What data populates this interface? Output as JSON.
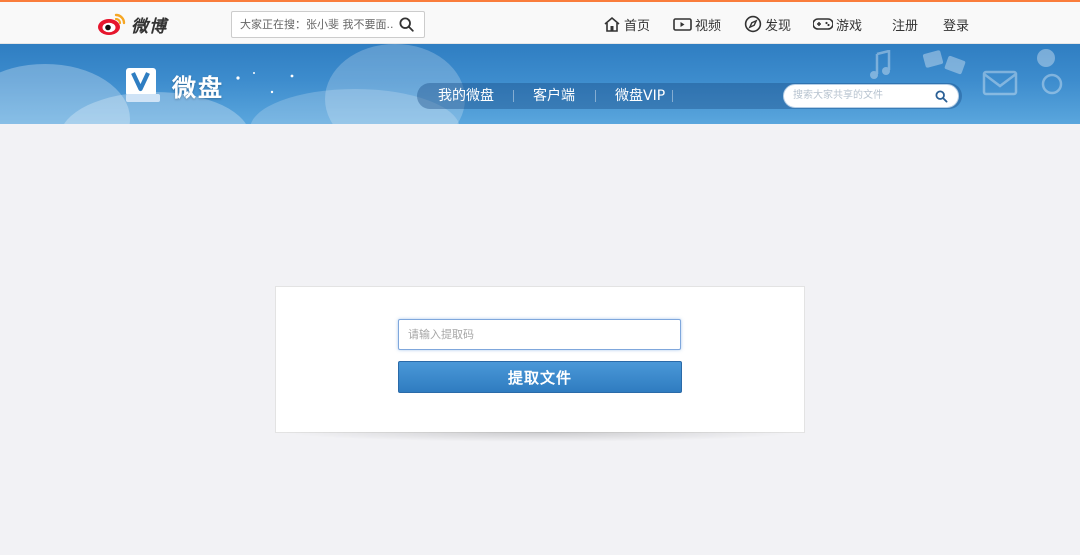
{
  "weibo": {
    "logo_text": "微博",
    "search_query": "大家正在搜：张小斐 我不要面...",
    "nav": [
      {
        "label": "首页",
        "icon": "home-icon"
      },
      {
        "label": "视频",
        "icon": "video-icon"
      },
      {
        "label": "发现",
        "icon": "compass-icon"
      },
      {
        "label": "游戏",
        "icon": "gamepad-icon"
      }
    ],
    "register_label": "注册",
    "login_label": "登录"
  },
  "disk": {
    "title": "微盘",
    "menu": [
      "我的微盘",
      "客户端",
      "微盘VIP"
    ],
    "search_placeholder": "搜索大家共享的文件"
  },
  "extract": {
    "input_placeholder": "请输入提取码",
    "button_label": "提取文件"
  },
  "colors": {
    "accent_orange": "#fa7d3c",
    "banner_blue": "#2f7ec2",
    "button_blue": "#3a88cc",
    "page_bg": "#f2f2f5"
  }
}
